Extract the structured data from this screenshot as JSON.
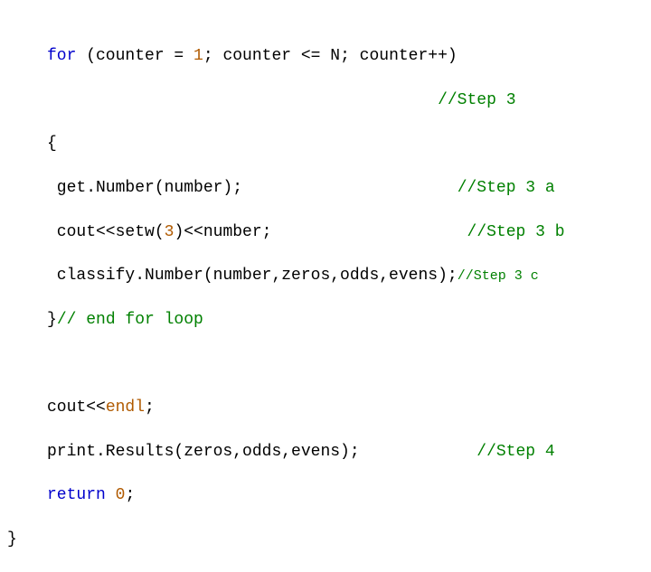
{
  "code": {
    "l1": {
      "for_kw": "for",
      "rest": " (counter = ",
      "one": "1",
      "rest2": "; counter <= N; counter++)"
    },
    "l2": {
      "cmt": "//Step 3"
    },
    "l3": {
      "brace": "{"
    },
    "l4": {
      "code": " get.Number(number);",
      "cmt": "//Step 3 a"
    },
    "l5": {
      "code": " cout<<setw(",
      "three": "3",
      "code2": ")<<number;",
      "cmt": "//Step 3 b"
    },
    "l6": {
      "code": " classify.Number(number,zeros,odds,evens);",
      "cmt": "//Step 3 c"
    },
    "l7": {
      "brace": "}",
      "cmt": "// end for loop"
    },
    "l8": {
      "code": "cout<<",
      "endl": "endl",
      "semi": ";"
    },
    "l9": {
      "code": "print.Results(zeros,odds,evens);",
      "cmt": "//Step 4"
    },
    "l10": {
      "ret": "return",
      "sp": " ",
      "zero": "0",
      "semi": ";"
    },
    "l11": {
      "brace": "}"
    }
  }
}
